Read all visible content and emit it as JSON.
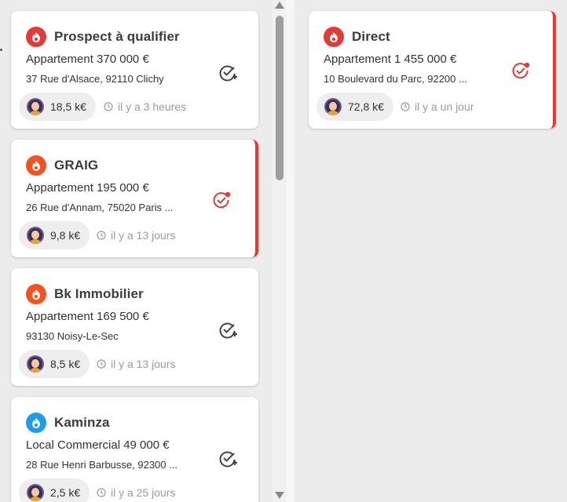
{
  "colors": {
    "accent_red": "#e53935",
    "source_orange": "#f4511e",
    "source_blue": "#2196f3",
    "check_dark": "#444444"
  },
  "left_column": {
    "cards": [
      {
        "source_icon": "flame-icon",
        "source_color": "#e53935",
        "title": "Prospect à qualifier",
        "line1": "Appartement 370 000 €",
        "line2": "37 Rue d'Alsace, 92110 Clichy",
        "fee": "18,5 k€",
        "time": "il y a 3 heures",
        "status_icon": "check-add-icon",
        "alert": false
      },
      {
        "source_icon": "flame-icon",
        "source_color": "#f4511e",
        "title": "GRAIG",
        "line1": "Appartement 195 000 €",
        "line2": "26 Rue d'Annam, 75020 Paris ...",
        "fee": "9,8 k€",
        "time": "il y a 13 jours",
        "status_icon": "check-alert-icon",
        "alert": true
      },
      {
        "source_icon": "flame-icon",
        "source_color": "#f4511e",
        "title": "Bk Immobilier",
        "line1": "Appartement 169 500 €",
        "line2": "93130 Noisy-Le-Sec",
        "fee": "8,5 k€",
        "time": "il y a 13 jours",
        "status_icon": "check-add-icon",
        "alert": false
      },
      {
        "source_icon": "flame-icon",
        "source_color": "#1e9be9",
        "title": "Kaminza",
        "line1": "Local Commercial 49 000 €",
        "line2": "28 Rue Henri Barbusse, 92300 ...",
        "fee": "2,5 k€",
        "time": "il y a 25 jours",
        "status_icon": "check-add-icon",
        "alert": false
      }
    ]
  },
  "right_column": {
    "cards": [
      {
        "source_icon": "flame-icon",
        "source_color": "#e53935",
        "title": "Direct",
        "line1": "Appartement 1 455 000 €",
        "line2": "10 Boulevard du Parc, 92200 ...",
        "fee": "72,8 k€",
        "time": "il y a un jour",
        "status_icon": "check-alert-icon",
        "alert": true
      }
    ]
  }
}
